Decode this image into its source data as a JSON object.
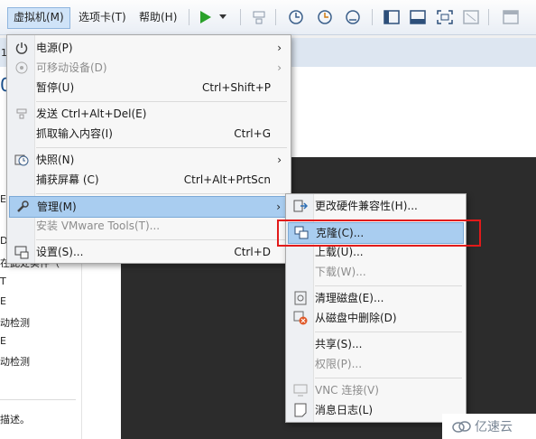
{
  "menubar": {
    "vm_menu": "虚拟机(M)",
    "tabs_menu": "选项卡(T)",
    "help_menu": "帮助(H)"
  },
  "vm_menu": {
    "items": [
      {
        "label": "电源(P)",
        "shortcut": "",
        "submenu": true,
        "enabled": true,
        "icon": "power-icon"
      },
      {
        "label": "可移动设备(D)",
        "shortcut": "",
        "submenu": true,
        "enabled": false,
        "icon": "removable-device-icon"
      },
      {
        "label": "暂停(U)",
        "shortcut": "Ctrl+Shift+P",
        "submenu": false,
        "enabled": true,
        "icon": ""
      },
      {
        "label": "发送 Ctrl+Alt+Del(E)",
        "shortcut": "",
        "submenu": false,
        "enabled": true,
        "icon": "send-keys-icon"
      },
      {
        "label": "抓取输入内容(I)",
        "shortcut": "Ctrl+G",
        "submenu": false,
        "enabled": true,
        "icon": ""
      },
      {
        "label": "快照(N)",
        "shortcut": "",
        "submenu": true,
        "enabled": true,
        "icon": "snapshot-icon"
      },
      {
        "label": "捕获屏幕 (C)",
        "shortcut": "Ctrl+Alt+PrtScn",
        "submenu": false,
        "enabled": true,
        "icon": ""
      },
      {
        "label": "管理(M)",
        "shortcut": "",
        "submenu": true,
        "enabled": true,
        "icon": "wrench-icon"
      },
      {
        "label": "安装 VMware Tools(T)...",
        "shortcut": "",
        "submenu": false,
        "enabled": false,
        "icon": ""
      },
      {
        "label": "设置(S)...",
        "shortcut": "Ctrl+D",
        "submenu": false,
        "enabled": true,
        "icon": "settings-icon"
      }
    ]
  },
  "manage_menu": {
    "items": [
      {
        "label": "更改硬件兼容性(H)...",
        "enabled": true,
        "icon": "hardware-compat-icon"
      },
      {
        "label": "克隆(C)...",
        "enabled": true,
        "icon": "clone-icon"
      },
      {
        "label": "上载(U)...",
        "enabled": true,
        "icon": ""
      },
      {
        "label": "下载(W)...",
        "enabled": false,
        "icon": ""
      },
      {
        "label": "清理磁盘(E)...",
        "enabled": true,
        "icon": "clean-disk-icon"
      },
      {
        "label": "从磁盘中删除(D)",
        "enabled": true,
        "icon": "delete-from-disk-icon"
      },
      {
        "label": "共享(S)...",
        "enabled": true,
        "icon": ""
      },
      {
        "label": "权限(P)...",
        "enabled": false,
        "icon": ""
      },
      {
        "label": "VNC 连接(V)",
        "enabled": false,
        "icon": "vnc-icon"
      },
      {
        "label": "消息日志(L)",
        "enabled": true,
        "icon": "message-log-icon"
      }
    ]
  },
  "background": {
    "left_fragments": [
      "E",
      "D",
      "在此处实件（",
      "T",
      "E",
      "动检测",
      "E",
      "动检测",
      "描述。"
    ],
    "edge_char": "0",
    "tab_char": "1"
  },
  "watermark": "亿速云",
  "colors": {
    "highlight": "#a9cdf0",
    "red_box": "#e21a1a",
    "play_green": "#2aa12a"
  }
}
